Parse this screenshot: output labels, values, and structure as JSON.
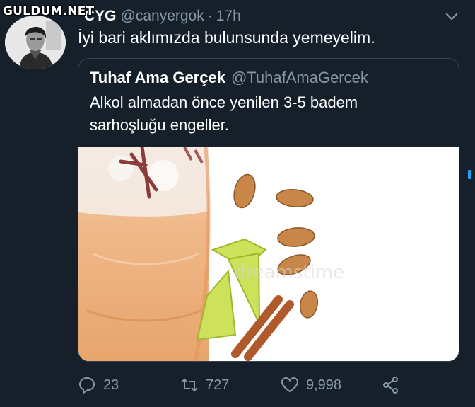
{
  "watermark": {
    "text": "GULDUM.NET"
  },
  "tweet": {
    "display_name": "CYG",
    "handle": "@canyergok",
    "separator": "·",
    "time": "17h",
    "text": "İyi bari aklımızda bulunsunda yemeyelim.",
    "avatar_icon": "user-avatar-photo",
    "menu_icon": "chevron-down-icon"
  },
  "quote": {
    "display_name": "Tuhaf Ama Gerçek",
    "handle": "@TuhafAmaGercek",
    "line1": "Alkol almadan önce yenilen 3-5 badem",
    "line2": "sarhoşluğu engeller.",
    "media_icon": "cocktail-almonds-lime-photo",
    "media_watermark": "dreamstime"
  },
  "actions": {
    "reply": {
      "icon": "reply-icon",
      "count": "23"
    },
    "retweet": {
      "icon": "retweet-icon",
      "count": "727"
    },
    "like": {
      "icon": "heart-icon",
      "count": "9,998"
    },
    "share": {
      "icon": "share-icon"
    }
  },
  "colors": {
    "background": "#15202b",
    "text_primary": "#ffffff",
    "text_secondary": "#8899a6",
    "border": "#38444d",
    "accent": "#1da1f2"
  }
}
